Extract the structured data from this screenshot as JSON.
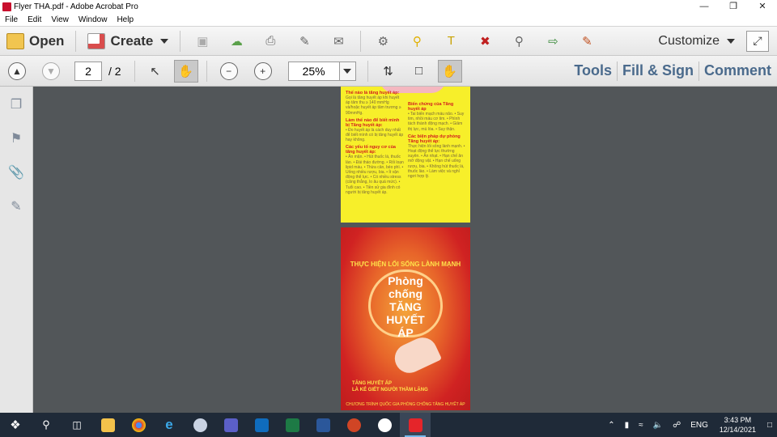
{
  "window": {
    "title": "Flyer THA.pdf - Adobe Acrobat Pro",
    "controls": [
      "minimize",
      "restore",
      "close"
    ]
  },
  "menubar": {
    "items": [
      "File",
      "Edit",
      "View",
      "Window",
      "Help"
    ]
  },
  "toolbar": {
    "open_label": "Open",
    "create_label": "Create",
    "icons": [
      "save-icon",
      "upload-icon",
      "print-icon",
      "edit-icon",
      "email-icon",
      "gear-icon",
      "comment-icon",
      "text-highlight-icon",
      "delete-page-icon",
      "search-doc-icon",
      "export-icon",
      "sign-icon"
    ],
    "customize_label": "Customize"
  },
  "navbar": {
    "page_current": "2",
    "page_total": "/ 2",
    "zoom": "25%",
    "tabs": [
      "Tools",
      "Fill & Sign",
      "Comment"
    ]
  },
  "document": {
    "page1": {
      "col1": [
        {
          "heading": "Thế nào là tăng huyết áp:",
          "body": "Gọi là tăng huyết áp khi huyết áp tâm thu ≥ 140 mmHg và/hoặc huyết áp tâm trương ≥ 90mmHg."
        },
        {
          "heading": "Làm thế nào để biết mình bị Tăng huyết áp:",
          "body": "• Đo huyết áp là cách duy nhất để biết mình có bị tăng huyết áp hay không."
        },
        {
          "heading": "Các yếu tố nguy cơ của tăng huyết áp:",
          "body": "• Ăn mặn. • Hút thuốc lá, thuốc lào. • Đái tháo đường. • Rối loạn lipid máu. • Thừa cân, béo phì. • Uống nhiều rượu, bia. • Ít vận động thể lực. • Có nhiều stress (căng thẳng, lo âu quá mức). • Tuổi cao. • Tiền sử gia đình có người bị tăng huyết áp."
        }
      ],
      "col2": [
        {
          "heading": "Biến chứng của Tăng huyết áp",
          "body": "• Tai biến mạch máu não. • Suy tim, nhồi máu cơ tim. • Phình tách thành động mạch. • Giảm thị lực, mù lòa. • Suy thận."
        },
        {
          "heading": "Các biện pháp dự phòng Tăng huyết áp:",
          "body": "Thực hiện lối sống lành mạnh. • Hoạt động thể lực thường xuyên. • Ăn nhạt. • Hạn chế ăn mỡ động vật. • Hạn chế uống rượu, bia. • Không hút thuốc lá, thuốc lào. • Làm việc và nghỉ ngơi hợp lý."
        }
      ]
    },
    "page2": {
      "top_text": "THỰC HIỆN LỐI SỐNG LÀNH MẠNH",
      "line1": "Phòng",
      "line2": "chống",
      "line3": "TĂNG",
      "line4": "HUYẾT",
      "line5": "ÁP",
      "bottom1": "TĂNG HUYẾT ÁP",
      "bottom2": "LÀ KẺ GIẾT NGƯỜI THẦM LẶNG",
      "bottom3": "CHƯƠNG TRÌNH QUỐC GIA PHÒNG CHỐNG TĂNG HUYẾT ÁP"
    }
  },
  "taskbar": {
    "apps": [
      "start",
      "search",
      "task-view",
      "file-explorer",
      "chrome",
      "internet-explorer",
      "snipping-tool",
      "teams",
      "outlook",
      "excel",
      "word",
      "powerpoint",
      "screen-capture",
      "acrobat"
    ],
    "language": "ENG",
    "time": "3:43 PM",
    "date": "12/14/2021"
  },
  "colors": {
    "toolbar_tab": "#4a6a8c",
    "doc_background": "#525659",
    "taskbar": "#1f2a38"
  }
}
